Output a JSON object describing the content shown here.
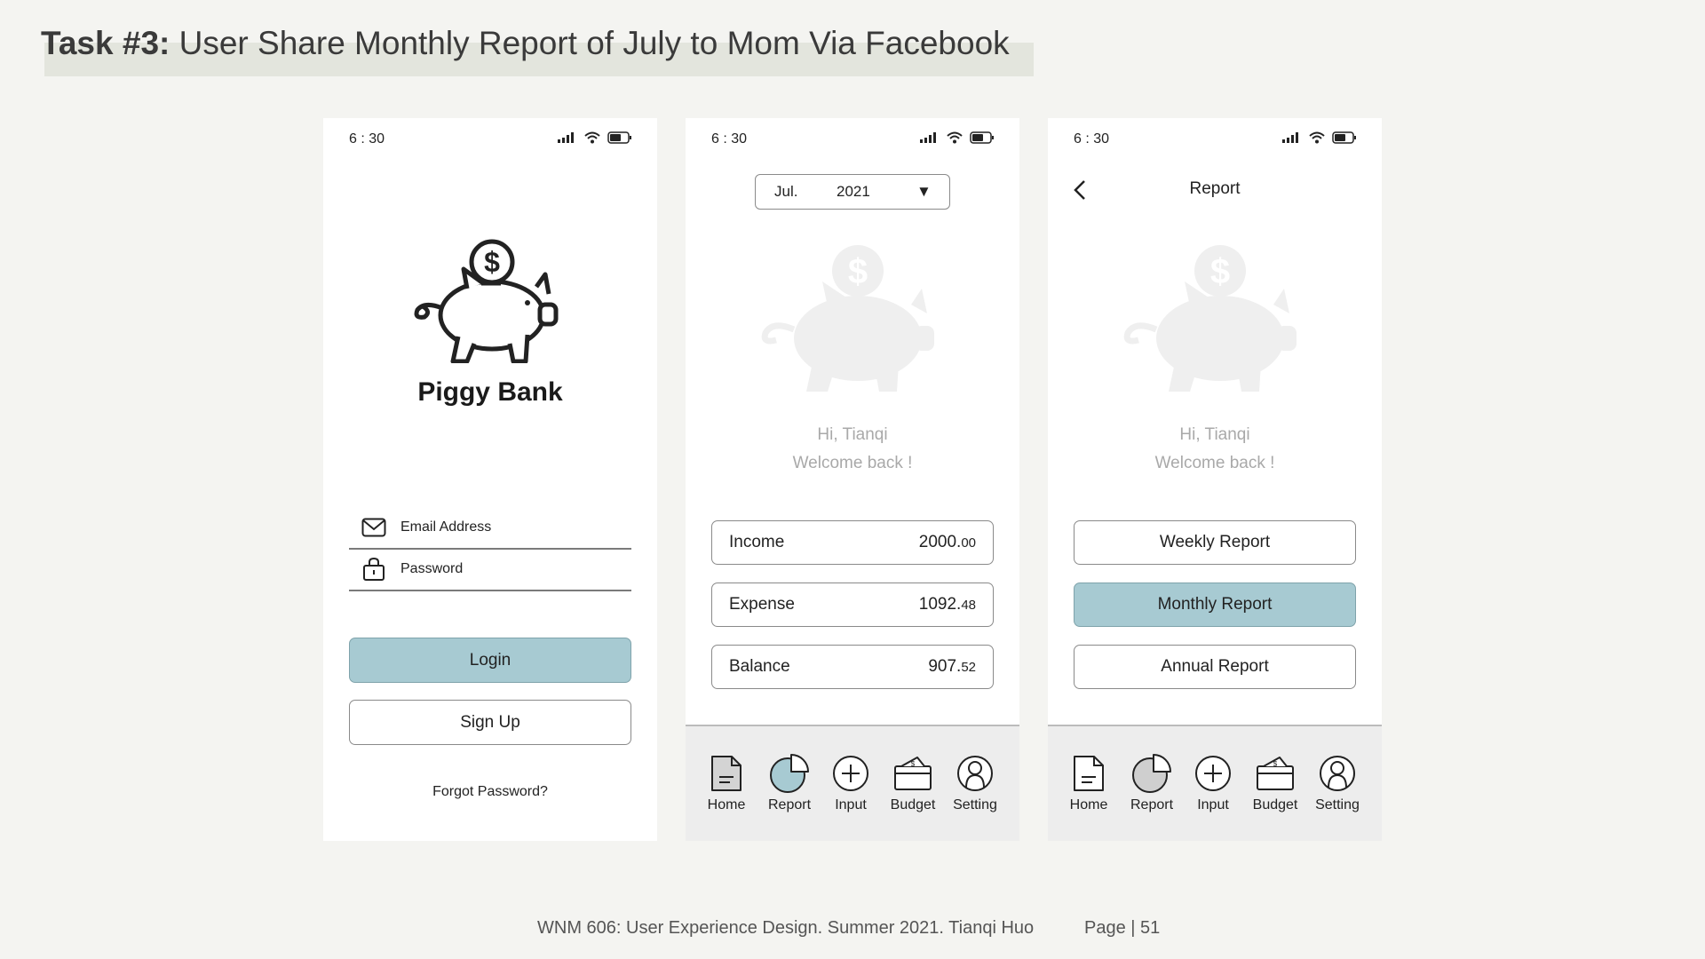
{
  "slide": {
    "title_bold": "Task #3:",
    "title_rest": " User Share Monthly Report of July to Mom Via Facebook",
    "footer_course": "WNM 606: User Experience Design. Summer 2021. Tianqi Huo",
    "footer_page": "Page | 51"
  },
  "colors": {
    "accent": "#a7cad2",
    "background": "#f4f4f1",
    "faded": "#e6e6e6"
  },
  "status_bar": {
    "time": "6 : 30",
    "icons": [
      "signal-icon",
      "wifi-icon",
      "battery-icon"
    ]
  },
  "login_screen": {
    "app_name": "Piggy Bank",
    "email_label": "Email Address",
    "password_label": "Password",
    "login_label": "Login",
    "signup_label": "Sign Up",
    "forgot_label": "Forgot Password?"
  },
  "home_screen": {
    "month": "Jul.",
    "year": "2021",
    "greeting": "Hi, Tianqi",
    "welcome": "Welcome back !",
    "rows": [
      {
        "label": "Income",
        "value_int": "2000.",
        "value_cents": "00"
      },
      {
        "label": "Expense",
        "value_int": "1092.",
        "value_cents": "48"
      },
      {
        "label": "Balance",
        "value_int": "907.",
        "value_cents": "52"
      }
    ]
  },
  "report_screen": {
    "title": "Report",
    "greeting": "Hi, Tianqi",
    "welcome": "Welcome back !",
    "buttons": [
      "Weekly Report",
      "Monthly Report",
      "Annual Report"
    ],
    "selected": "Monthly Report"
  },
  "tabbar": {
    "tabs": [
      "Home",
      "Report",
      "Input",
      "Budget",
      "Setting"
    ]
  }
}
